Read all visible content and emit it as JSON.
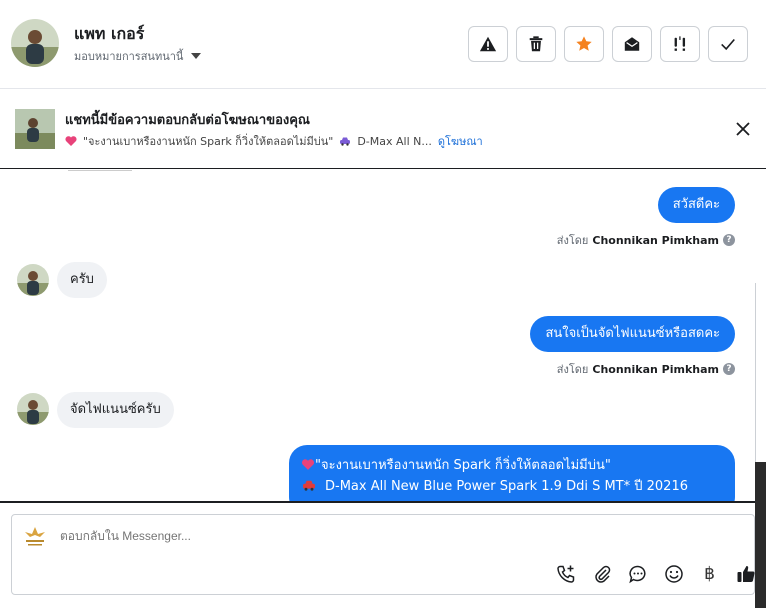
{
  "header": {
    "contact_name": "แพท เกอร์",
    "assign_label": "มอบหมายการสนทนานี้",
    "actions": [
      "warning-icon",
      "trash-icon",
      "star-icon",
      "envelope-open-icon",
      "follow-up-icon",
      "check-icon"
    ],
    "star_color": "#f5821f"
  },
  "ad_banner": {
    "title": "แชทนี้มีข้อความตอบกลับต่อโฆษณาของคุณ",
    "quote": "\"จะงานเบาหรืองานหนัก Spark ก็วิ่งให้ตลอดไม่มีบ่น\"",
    "car": "D-Max All N...",
    "link": "ดูโฆษณา"
  },
  "messages": {
    "m1": "สวัสดีคะ",
    "sent_by_label": "ส่งโดย",
    "agent": "Chonnikan Pimkham",
    "m2": "ครับ",
    "m3": "สนใจเป็นจัดไฟแนนซ์หรือสดคะ",
    "m4": "จัดไฟแนนซ์ครับ",
    "m5_line1": "\"จะงานเบาหรืองานหนัก Spark ก็วิ่งให้ตลอดไม่มีบ่น\"",
    "m5_line2": "D-Max All New Blue Power Spark 1.9 Ddi S MT* ปี 20216"
  },
  "composer": {
    "placeholder": "ตอบกลับใน Messenger..."
  },
  "colors": {
    "accent": "#1877f2",
    "link": "#1a6ed8"
  }
}
